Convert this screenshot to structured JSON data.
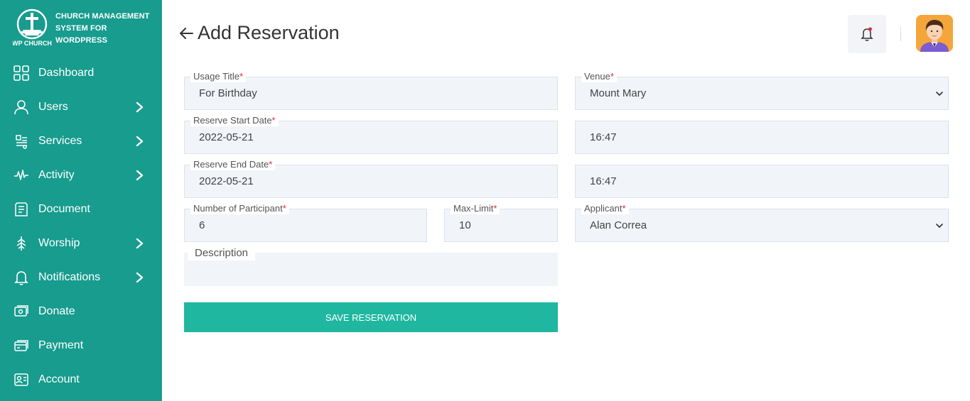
{
  "brand": {
    "logo_text": "WP CHURCH",
    "line1": "CHURCH MANAGEMENT",
    "line2": "SYSTEM FOR",
    "line3": "WORDPRESS"
  },
  "sidebar": {
    "items": [
      {
        "label": "Dashboard",
        "icon": "dashboard-icon",
        "has_submenu": false
      },
      {
        "label": "Users",
        "icon": "user-icon",
        "has_submenu": true
      },
      {
        "label": "Services",
        "icon": "services-icon",
        "has_submenu": true
      },
      {
        "label": "Activity",
        "icon": "activity-icon",
        "has_submenu": true
      },
      {
        "label": "Document",
        "icon": "document-icon",
        "has_submenu": false
      },
      {
        "label": "Worship",
        "icon": "worship-icon",
        "has_submenu": true
      },
      {
        "label": "Notifications",
        "icon": "bell-icon",
        "has_submenu": true
      },
      {
        "label": "Donate",
        "icon": "donate-icon",
        "has_submenu": false
      },
      {
        "label": "Payment",
        "icon": "payment-icon",
        "has_submenu": false
      },
      {
        "label": "Account",
        "icon": "account-icon",
        "has_submenu": false
      }
    ]
  },
  "header": {
    "back_icon": "arrow-left-icon",
    "title": "Add Reservation"
  },
  "form": {
    "usage_title": {
      "label": "Usage Title",
      "required": "*",
      "value": "For Birthday"
    },
    "venue": {
      "label": "Venue",
      "required": "*",
      "value": "Mount Mary"
    },
    "reserve_start_date": {
      "label": "Reserve Start Date",
      "required": "*",
      "value": "2022-05-21"
    },
    "reserve_start_time": {
      "value": "16:47"
    },
    "reserve_end_date": {
      "label": "Reserve End Date",
      "required": "*",
      "value": "2022-05-21"
    },
    "reserve_end_time": {
      "value": "16:47"
    },
    "participants": {
      "label": "Number of Participant",
      "required": "*",
      "value": "6"
    },
    "max_limit": {
      "label": "Max-Limit",
      "required": "*",
      "value": "10"
    },
    "applicant": {
      "label": "Applicant",
      "required": "*",
      "value": "Alan Correa"
    },
    "description": {
      "label": "Description",
      "value": ""
    },
    "save_label": "SAVE RESERVATION"
  },
  "colors": {
    "sidebar": "#179c8e",
    "accent": "#20b7a1",
    "required": "#e0283a",
    "notification_dot": "#e0283a"
  }
}
